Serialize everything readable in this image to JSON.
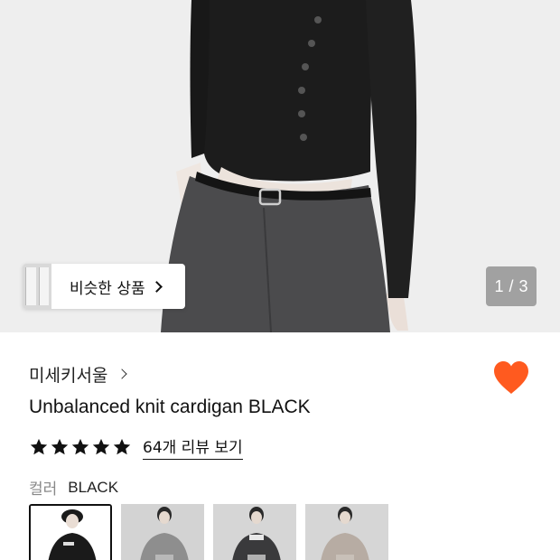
{
  "hero": {
    "similar_button": {
      "label": "비슷한 상품"
    },
    "pager": {
      "current": "1",
      "separator": "/",
      "total": "3"
    }
  },
  "product": {
    "brand": "미세키서울",
    "title": "Unbalanced knit cardigan BLACK",
    "rating_stars": 5,
    "review_link": "64개 리뷰 보기",
    "liked": true
  },
  "options": {
    "color_label": "컬러",
    "color_value": "BLACK",
    "swatches": [
      {
        "name": "black",
        "selected": true
      },
      {
        "name": "gray",
        "selected": false
      },
      {
        "name": "charcoal",
        "selected": false
      },
      {
        "name": "beige",
        "selected": false
      }
    ]
  },
  "colors": {
    "heart": "#ff5a1f",
    "text": "#111111",
    "muted": "#888888"
  }
}
